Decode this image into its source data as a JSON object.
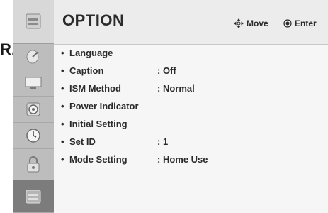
{
  "stray_text": "R.",
  "header": {
    "title": "OPTION",
    "move_label": "Move",
    "enter_label": "Enter"
  },
  "sidebar": {
    "items": [
      {
        "icon": "toolbox-icon",
        "active": false
      },
      {
        "icon": "satellite-dish-icon",
        "active": false
      },
      {
        "icon": "monitor-icon",
        "active": false
      },
      {
        "icon": "speaker-icon",
        "active": false
      },
      {
        "icon": "clock-icon",
        "active": false
      },
      {
        "icon": "lock-icon",
        "active": false
      },
      {
        "icon": "toolbox-icon",
        "active": true
      }
    ]
  },
  "menu": {
    "items": [
      {
        "label": "Language",
        "value": ""
      },
      {
        "label": "Caption",
        "value": ": Off"
      },
      {
        "label": "ISM Method",
        "value": ": Normal"
      },
      {
        "label": "Power Indicator",
        "value": ""
      },
      {
        "label": "Initial Setting",
        "value": ""
      },
      {
        "label": "Set ID",
        "value": ": 1"
      },
      {
        "label": "Mode Setting",
        "value": ": Home Use"
      }
    ]
  },
  "colors": {
    "panel": "#e9e9e9",
    "sidebar": "#bdbdbd",
    "sidebar_active": "#7c7c7c",
    "text": "#2b2b2b"
  }
}
